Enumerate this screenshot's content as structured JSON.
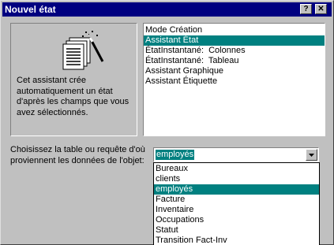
{
  "window": {
    "title": "Nouvel état",
    "help_label": "?",
    "close_label": "✕"
  },
  "preview": {
    "icon": "report-wizard-icon",
    "description": "Cet assistant crée automatiquement un état d'après les champs que vous avez sélectionnés."
  },
  "report_types": {
    "items": [
      {
        "label": "Mode Création",
        "selected": false
      },
      {
        "label": "Assistant État",
        "selected": true
      },
      {
        "label": "ÉtatInstantané:  Colonnes",
        "selected": false
      },
      {
        "label": "ÉtatInstantané:  Tableau",
        "selected": false
      },
      {
        "label": "Assistant Graphique",
        "selected": false
      },
      {
        "label": "Assistant Étiquette",
        "selected": false
      }
    ]
  },
  "source": {
    "label": "Choisissez la table ou requête d'où proviennent les données de l'objet:",
    "value": "employés",
    "options": [
      {
        "label": "Bureaux",
        "selected": false
      },
      {
        "label": "clients",
        "selected": false
      },
      {
        "label": "employés",
        "selected": true
      },
      {
        "label": "Facture",
        "selected": false
      },
      {
        "label": "Inventaire",
        "selected": false
      },
      {
        "label": "Occupations",
        "selected": false
      },
      {
        "label": "Statut",
        "selected": false
      },
      {
        "label": "Transition Fact-Inv",
        "selected": false
      }
    ]
  },
  "colors": {
    "title_bar": "#000080",
    "selection": "#008080",
    "face": "#c0c0c0"
  }
}
